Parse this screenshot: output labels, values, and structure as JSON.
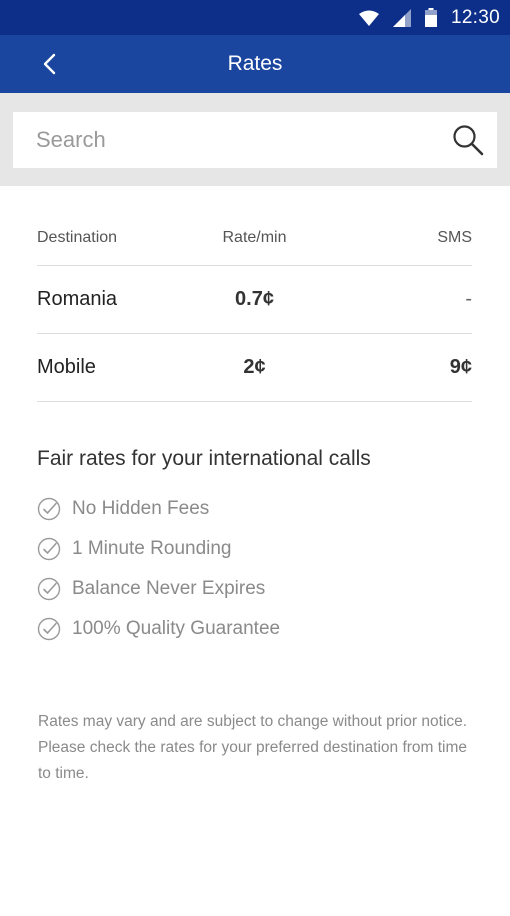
{
  "status_bar": {
    "time": "12:30",
    "icons": [
      "wifi-icon",
      "signal-icon",
      "battery-icon"
    ]
  },
  "app_bar": {
    "title": "Rates",
    "back_icon": "chevron-left-icon"
  },
  "search": {
    "placeholder": "Search",
    "icon": "search-icon"
  },
  "rates_table": {
    "headers": {
      "destination": "Destination",
      "rate": "Rate/min",
      "sms": "SMS"
    },
    "rows": [
      {
        "destination": "Romania",
        "rate": "0.7¢",
        "sms": "-"
      },
      {
        "destination": "Mobile",
        "rate": "2¢",
        "sms": "9¢"
      }
    ]
  },
  "fair_rates": {
    "title": "Fair rates for your international calls",
    "features": [
      "No Hidden Fees",
      "1 Minute Rounding",
      "Balance Never Expires",
      "100% Quality Guarantee"
    ]
  },
  "disclaimer": "Rates may vary and are subject to change without prior notice. Please check the rates for your preferred destination from time to time.",
  "colors": {
    "status_bar": "#0d2f8a",
    "app_bar": "#1a46a0",
    "search_bg": "#e6e6e6"
  }
}
